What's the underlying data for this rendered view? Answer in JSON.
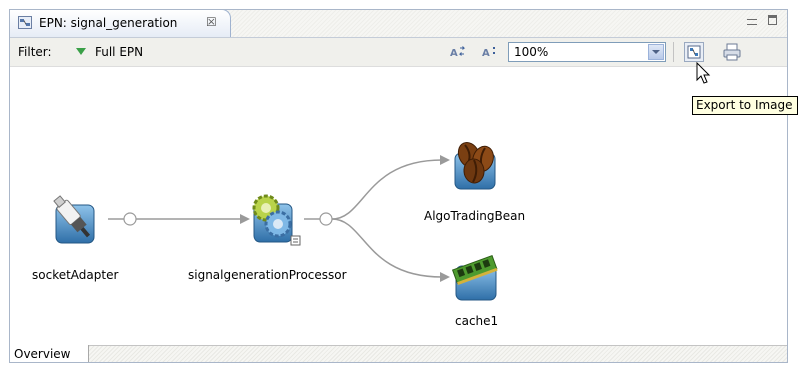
{
  "editor": {
    "tab_title": "EPN: signal_generation",
    "close_glyph": "☒"
  },
  "toolbar": {
    "filter_label": "Filter:",
    "filter_value": "Full EPN",
    "zoom_value": "100%"
  },
  "diagram": {
    "nodes": [
      {
        "id": "socketAdapter",
        "label": "socketAdapter",
        "icon": "usb-plug-icon"
      },
      {
        "id": "signalgenerationProcessor",
        "label": "signalgenerationProcessor",
        "icon": "gears-icon"
      },
      {
        "id": "AlgoTradingBean",
        "label": "AlgoTradingBean",
        "icon": "coffee-beans-icon"
      },
      {
        "id": "cache1",
        "label": "cache1",
        "icon": "memory-chip-icon"
      }
    ]
  },
  "tooltip": {
    "text": "Export to Image"
  },
  "bottom_tabs": {
    "overview": "Overview"
  },
  "colors": {
    "tab_border": "#9fb2cf",
    "node_tile": "#3d87c1",
    "connector": "#9a9a9a",
    "tooltip_bg": "#ffffe1"
  }
}
